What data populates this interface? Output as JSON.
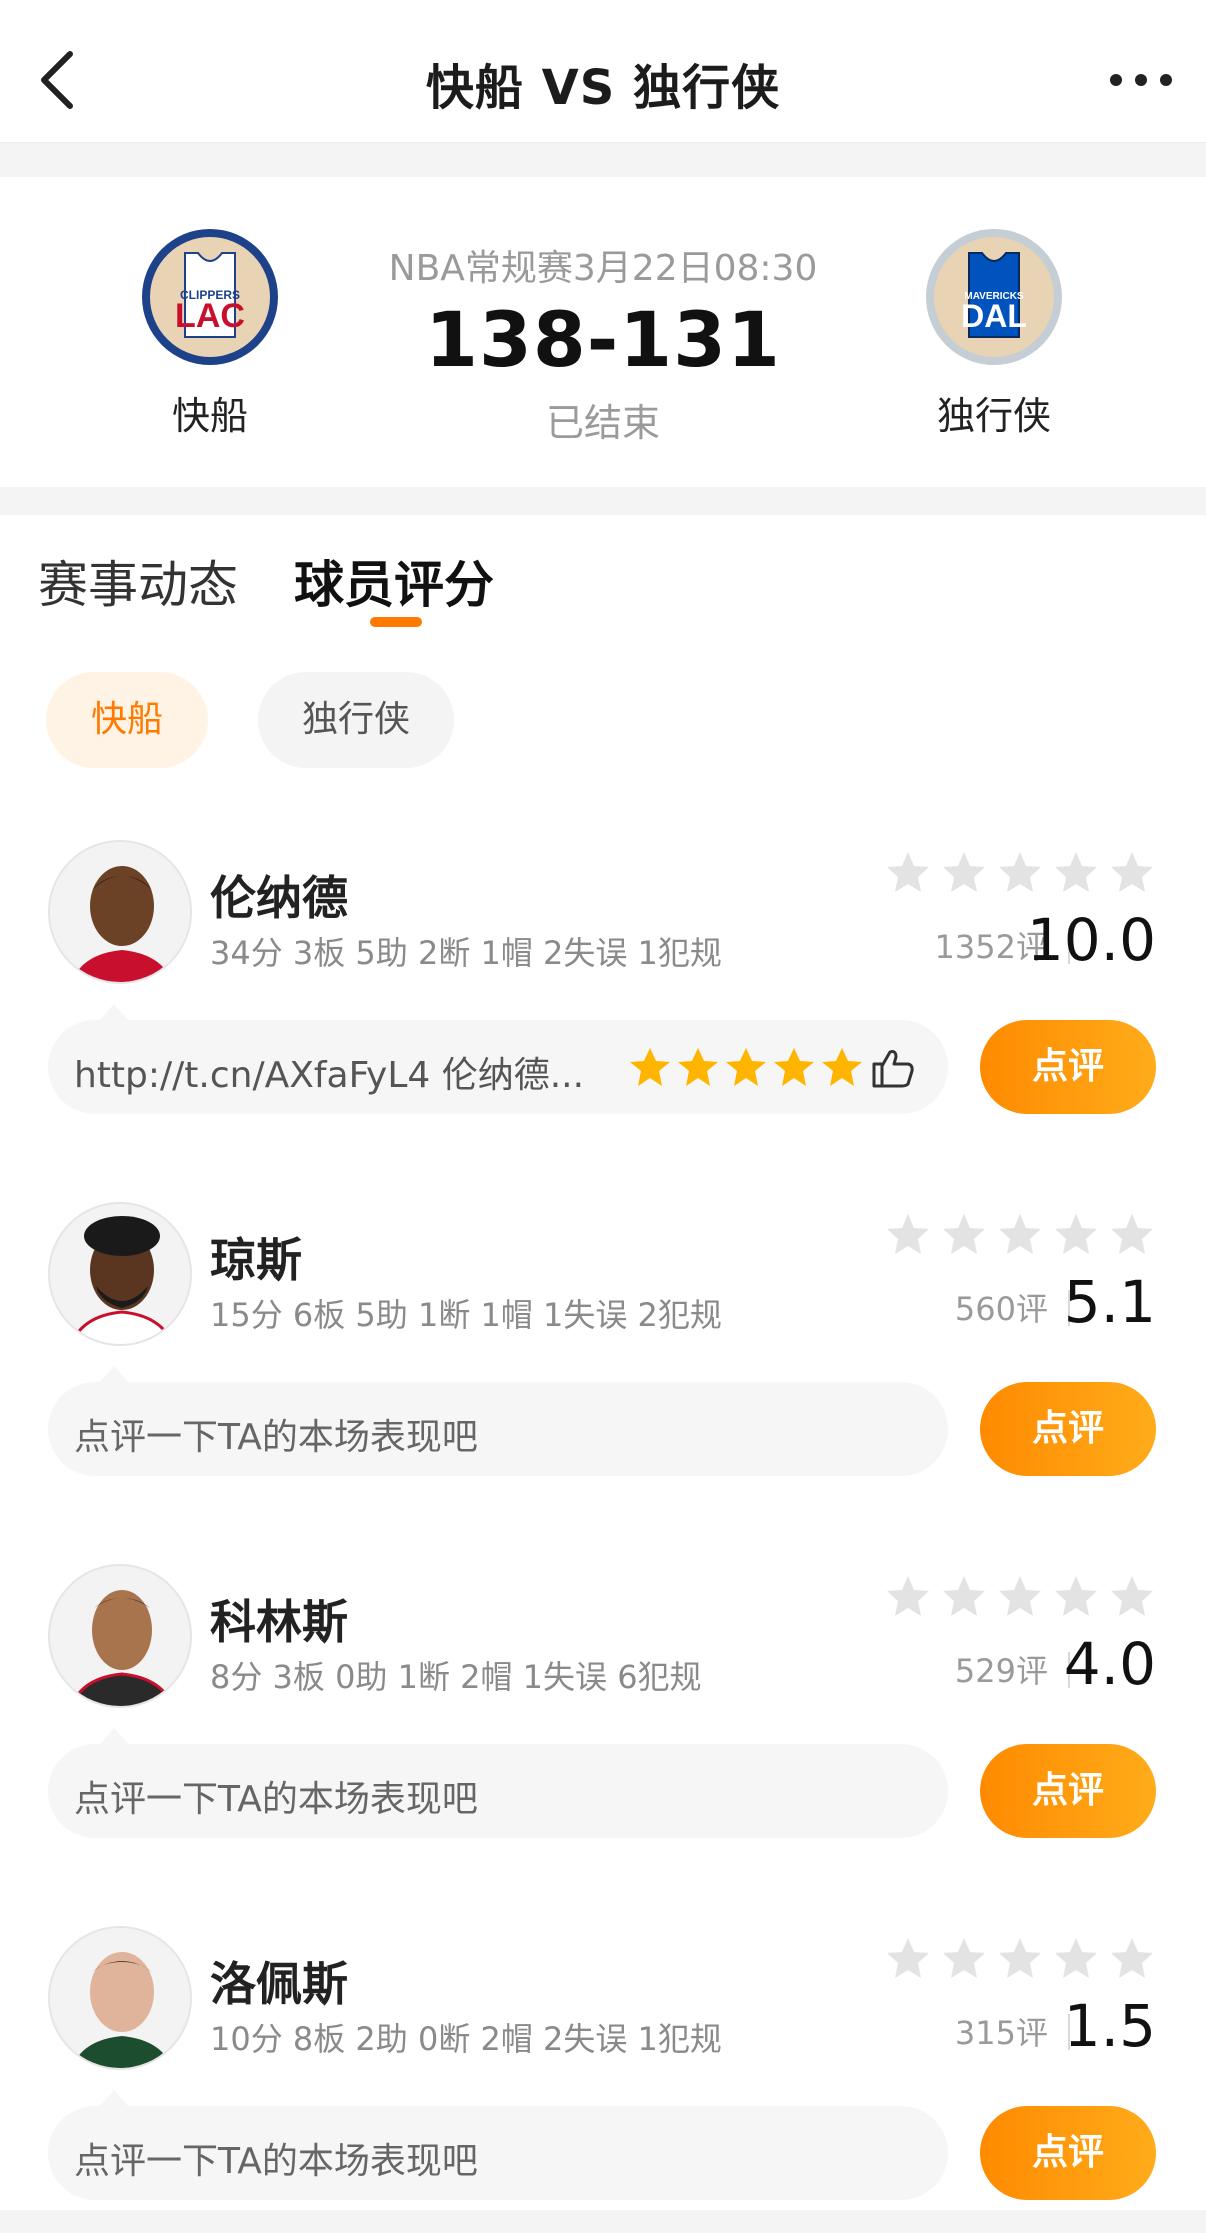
{
  "nav": {
    "title": "快船 VS 独行侠"
  },
  "match": {
    "home": {
      "name": "快船",
      "logo_text": "LAC",
      "logo_sub": "CLIPPERS",
      "color": "#c8102e"
    },
    "away": {
      "name": "独行侠",
      "logo_text": "DAL",
      "logo_sub": "MAVERICKS",
      "color": "#0053bc"
    },
    "league_time": "NBA常规赛3月22日08:30",
    "score": "138-131",
    "status": "已结束"
  },
  "tabs": [
    {
      "label": "赛事动态"
    },
    {
      "label": "球员评分"
    }
  ],
  "team_switch": [
    {
      "label": "快船"
    },
    {
      "label": "独行侠"
    }
  ],
  "players": [
    {
      "name": "伦纳德",
      "stats": "34分 3板 5助 2断 1帽 2失误 1犯规",
      "rate_count": "1352评",
      "score": "10.0",
      "comment": "http://t.cn/AXfaFyL4 伦纳德...",
      "comment_rating": 5,
      "button": "点评"
    },
    {
      "name": "琼斯",
      "stats": "15分 6板 5助 1断 1帽 1失误 2犯规",
      "rate_count": "560评",
      "score": "5.1",
      "comment": "点评一下TA的本场表现吧",
      "button": "点评"
    },
    {
      "name": "科林斯",
      "stats": "8分 3板 0助 1断 2帽 1失误 6犯规",
      "rate_count": "529评",
      "score": "4.0",
      "comment": "点评一下TA的本场表现吧",
      "button": "点评"
    },
    {
      "name": "洛佩斯",
      "stats": "10分 8板 2助 0断 2帽 2失误 1犯规",
      "rate_count": "315评",
      "score": "1.5",
      "comment": "点评一下TA的本场表现吧",
      "button": "点评"
    }
  ],
  "colors": {
    "accent": "#ff7a00",
    "star_empty": "#e3e3e3",
    "star_full": "#ffb400"
  }
}
